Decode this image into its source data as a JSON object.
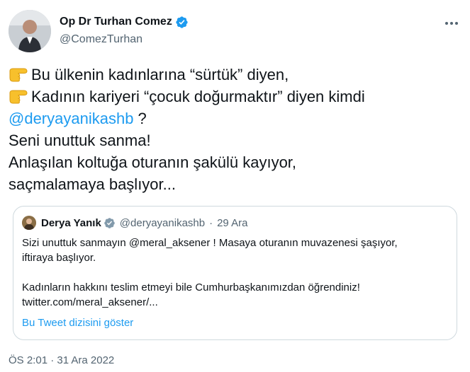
{
  "author": {
    "display_name": "Op Dr Turhan Comez",
    "handle": "@ComezTurhan",
    "verified": true,
    "verified_color": "#1d9bf0"
  },
  "menu_icon": "more-horizontal-icon",
  "tweet": {
    "line1": "Bu ülkenin kadınlarına “sürtük” diyen,",
    "line2": "Kadının kariyeri “çocuk doğurmaktır” diyen kimdi",
    "mention": "@deryayanikashb",
    "mention_suffix": " ?",
    "line4": "Seni unuttuk sanma!",
    "line5": "Anlaşılan koltuğa oturanın şakülü kayıyor,",
    "line6": "saçmalamaya başlıyor...",
    "emoji": "backhand-index-pointing-right"
  },
  "quoted_tweet": {
    "display_name": "Derya Yanık",
    "handle": "@deryayanikashb",
    "separator": "·",
    "date": "29 Ara",
    "line1_prefix": "Sizi unuttuk sanmayın ",
    "line1_mention": "@meral_aksener",
    "line1_suffix": " ! Masaya oturanın muvazenesi şaşıyor,",
    "line2": "iftiraya başlıyor.",
    "line3": "Kadınların hakkını teslim etmeyi bile Cumhurbaşkanımızdan öğrendiniz!",
    "line4": "twitter.com/meral_aksener/...",
    "show_thread": "Bu Tweet dizisini göster"
  },
  "timestamp": "ÖS 2:01 · 31 Ara 2022",
  "colors": {
    "link": "#1d9bf0",
    "secondary_text": "#536471",
    "border": "#cfd9de"
  }
}
